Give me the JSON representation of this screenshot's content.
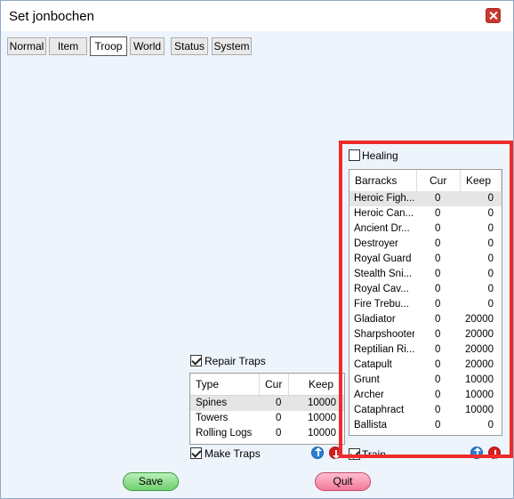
{
  "window": {
    "title": "Set jonbochen"
  },
  "tabs": [
    {
      "label": "Normal"
    },
    {
      "label": "Item"
    },
    {
      "label": "Troop"
    },
    {
      "label": "World"
    },
    {
      "label": "Status"
    },
    {
      "label": "System"
    }
  ],
  "active_tab": "Troop",
  "traps": {
    "repair_label": "Repair Traps",
    "repair_checked": true,
    "columns": {
      "type": "Type",
      "cur": "Cur",
      "keep": "Keep"
    },
    "rows": [
      {
        "name": "Spines",
        "cur": "0",
        "keep": "10000"
      },
      {
        "name": "Towers",
        "cur": "0",
        "keep": "10000"
      },
      {
        "name": "Rolling Logs",
        "cur": "0",
        "keep": "10000"
      }
    ],
    "make_label": "Make Traps",
    "make_checked": true
  },
  "troops": {
    "healing_label": "Healing",
    "healing_checked": false,
    "columns": {
      "barracks": "Barracks",
      "cur": "Cur",
      "keep": "Keep"
    },
    "rows": [
      {
        "name": "Heroic Figh...",
        "cur": "0",
        "keep": "0"
      },
      {
        "name": "Heroic Can...",
        "cur": "0",
        "keep": "0"
      },
      {
        "name": "Ancient Dr...",
        "cur": "0",
        "keep": "0"
      },
      {
        "name": "Destroyer",
        "cur": "0",
        "keep": "0"
      },
      {
        "name": "Royal Guard",
        "cur": "0",
        "keep": "0"
      },
      {
        "name": "Stealth Sni...",
        "cur": "0",
        "keep": "0"
      },
      {
        "name": "Royal Cav...",
        "cur": "0",
        "keep": "0"
      },
      {
        "name": "Fire Trebu...",
        "cur": "0",
        "keep": "0"
      },
      {
        "name": "Gladiator",
        "cur": "0",
        "keep": "20000"
      },
      {
        "name": "Sharpshooter",
        "cur": "0",
        "keep": "20000"
      },
      {
        "name": "Reptilian Ri...",
        "cur": "0",
        "keep": "20000"
      },
      {
        "name": "Catapult",
        "cur": "0",
        "keep": "20000"
      },
      {
        "name": "Grunt",
        "cur": "0",
        "keep": "10000"
      },
      {
        "name": "Archer",
        "cur": "0",
        "keep": "10000"
      },
      {
        "name": "Cataphract",
        "cur": "0",
        "keep": "10000"
      },
      {
        "name": "Ballista",
        "cur": "0",
        "keep": "0"
      }
    ],
    "train_label": "Train",
    "train_checked": true
  },
  "buttons": {
    "save": "Save",
    "quit": "Quit"
  },
  "icons": {
    "close": "close-icon",
    "move_up": "arrow-up-icon",
    "move_down": "arrow-down-icon"
  },
  "colors": {
    "highlight": "#ef2b2b",
    "save": "#6fcf6f",
    "quit": "#f2789a",
    "up": "#2a7fd4",
    "down": "#d41f1f"
  }
}
